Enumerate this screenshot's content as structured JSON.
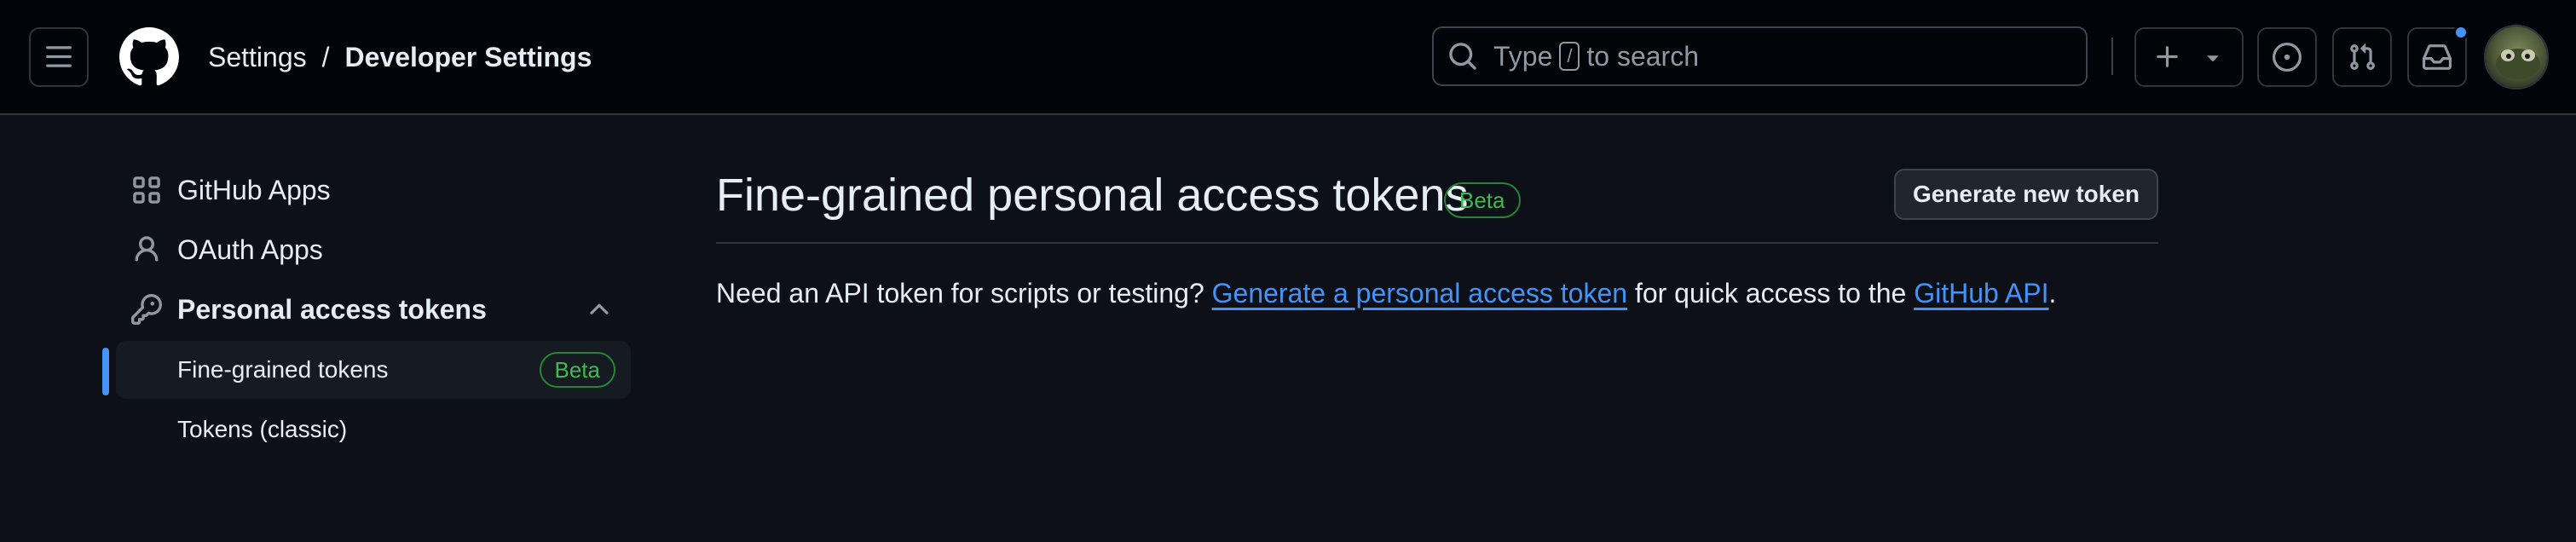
{
  "header": {
    "breadcrumb": {
      "parent": "Settings",
      "separator": "/",
      "current": "Developer Settings"
    },
    "search": {
      "prefix": "Type",
      "key": "/",
      "suffix": "to search"
    },
    "icons": [
      "hamburger-icon",
      "github-logo-icon",
      "search-icon",
      "plus-icon",
      "triangle-down-icon",
      "issue-opened-icon",
      "git-pull-request-icon",
      "inbox-icon"
    ],
    "notification_dot_color": "#4493f8"
  },
  "sidebar": {
    "items": [
      {
        "label": "GitHub Apps",
        "icon": "apps-icon"
      },
      {
        "label": "OAuth Apps",
        "icon": "person-icon"
      },
      {
        "label": "Personal access tokens",
        "icon": "key-icon",
        "expanded": true
      }
    ],
    "sub_items": [
      {
        "label": "Fine-grained tokens",
        "badge": "Beta",
        "active": true
      },
      {
        "label": "Tokens (classic)"
      }
    ]
  },
  "main": {
    "title": "Fine-grained personal access tokens",
    "title_badge": "Beta",
    "generate_button": "Generate new token",
    "description": {
      "before": "Need an API token for scripts or testing?",
      "link1": "Generate a personal access token",
      "middle": "for quick access to the",
      "link2": "GitHub API",
      "after": "."
    }
  },
  "colors": {
    "background": "#0d1117",
    "header_bg": "#010409",
    "link": "#4493f8",
    "beta_green": "#3fb950",
    "border": "#30363d"
  }
}
